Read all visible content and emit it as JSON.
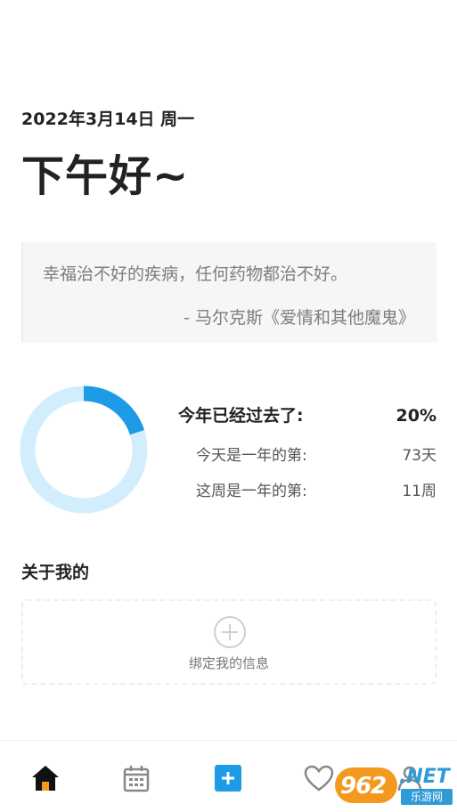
{
  "header": {
    "date": "2022年3月14日 周一",
    "greeting": "下午好~"
  },
  "quote": {
    "text": "幸福治不好的疾病，任何药物都治不好。",
    "source": "- 马尔克斯《爱情和其他魔鬼》"
  },
  "progress": {
    "year_elapsed_fraction": 0.2,
    "ring_colors": {
      "filled": "#1e9be6",
      "track": "#d2eefc"
    },
    "rows": [
      {
        "label": "今年已经过去了:",
        "value": "20%"
      },
      {
        "label": "今天是一年的第:",
        "value": "73天"
      },
      {
        "label": "这周是一年的第:",
        "value": "11周"
      }
    ]
  },
  "about": {
    "title": "关于我的",
    "bind_label": "绑定我的信息"
  },
  "bottom_nav": {
    "items": [
      {
        "icon": "home-icon",
        "active": true
      },
      {
        "icon": "calendar-icon",
        "active": false
      },
      {
        "icon": "add-icon",
        "active": false
      },
      {
        "icon": "heart-icon",
        "active": false
      },
      {
        "icon": "profile-icon",
        "active": false
      }
    ],
    "accent": "#1e9be6"
  },
  "watermark": {
    "number": "962",
    "net": ".NET",
    "sub": "乐游网"
  }
}
